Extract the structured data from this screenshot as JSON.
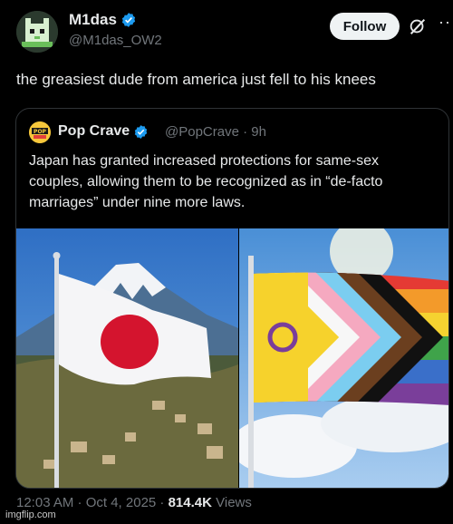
{
  "author": {
    "display_name": "M1das",
    "handle": "@M1das_OW2",
    "avatar_icon": "pixel-cat-avatar",
    "verified_icon": "verified-badge-icon"
  },
  "actions": {
    "follow_label": "Follow",
    "grok_icon": "grok-icon",
    "more_icon": "more-icon"
  },
  "tweet": {
    "text": "the greasiest dude from america just fell to his knees"
  },
  "quote": {
    "display_name": "Pop Crave",
    "handle_time": "@PopCrave · 9h",
    "logo_text": "POP CRAVE",
    "text": "Japan has granted increased protections for same-sex couples, allowing them to be recognized as in “de-facto marriages” under nine more laws.",
    "images": [
      "japan-flag-with-mount-fuji",
      "intersex-inclusive-progress-pride-flag"
    ]
  },
  "meta": {
    "timestamp": "12:03 AM · Oct 4, 2025 · ",
    "views_count": "814.4K",
    "views_label": " Views"
  },
  "watermark": "imgflip.com",
  "colors": {
    "background": "#000000",
    "text_primary": "#e7e9ea",
    "text_secondary": "#71767b",
    "verified_blue": "#1d9bf0",
    "follow_bg": "#eff3f4"
  }
}
